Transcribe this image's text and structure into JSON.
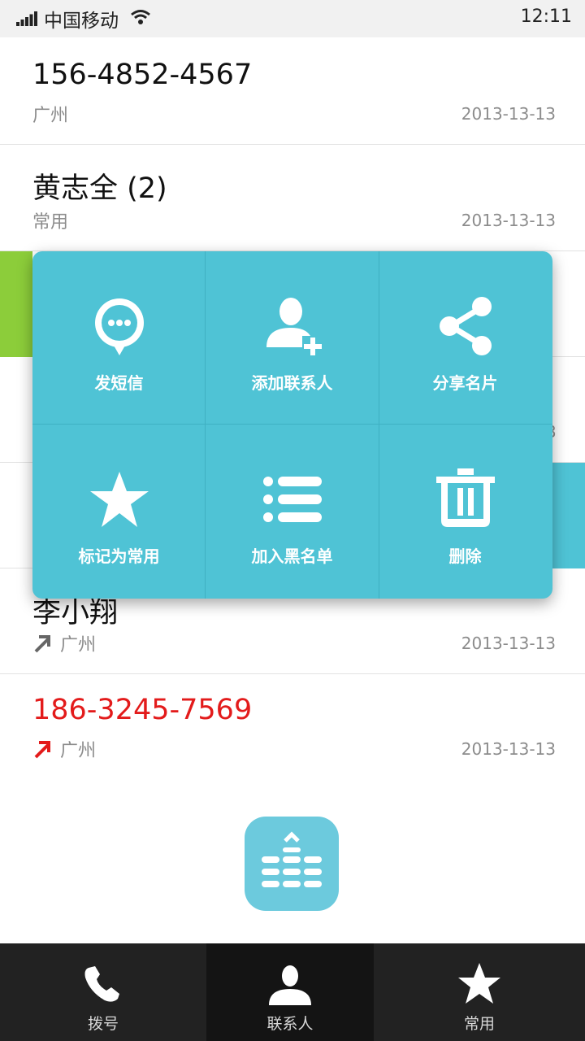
{
  "status_bar": {
    "carrier": "中国移动",
    "time": "12:11"
  },
  "calls": [
    {
      "name": "156-4852-4567",
      "sub": "广州",
      "date": "2013-13-13",
      "missed": false
    },
    {
      "name": "黄志全 (2)",
      "sub": "常用",
      "date": "2013-13-13",
      "missed": false
    },
    {
      "name": "李小翔",
      "sub": "广州",
      "date": "2013-13-13",
      "missed": false
    },
    {
      "name": "186-3245-7569",
      "sub": "广州",
      "date": "2013-13-13",
      "missed": true
    }
  ],
  "peek": {
    "digit": "3"
  },
  "menu": [
    {
      "label": "发短信",
      "icon": "message-icon"
    },
    {
      "label": "添加联系人",
      "icon": "add-contact-icon"
    },
    {
      "label": "分享名片",
      "icon": "share-icon"
    },
    {
      "label": "标记为常用",
      "icon": "star-icon"
    },
    {
      "label": "加入黑名单",
      "icon": "list-icon"
    },
    {
      "label": "删除",
      "icon": "trash-icon"
    }
  ],
  "nav": [
    {
      "label": "拨号",
      "icon": "phone-icon"
    },
    {
      "label": "联系人",
      "icon": "contacts-icon",
      "active": true
    },
    {
      "label": "常用",
      "icon": "star-icon"
    }
  ],
  "colors": {
    "accent": "#4fc3d5",
    "missed": "#e31b1b",
    "green_strip": "#8ccd3a",
    "blue_strip": "#4fc3d5",
    "nav_bg": "#222222"
  }
}
